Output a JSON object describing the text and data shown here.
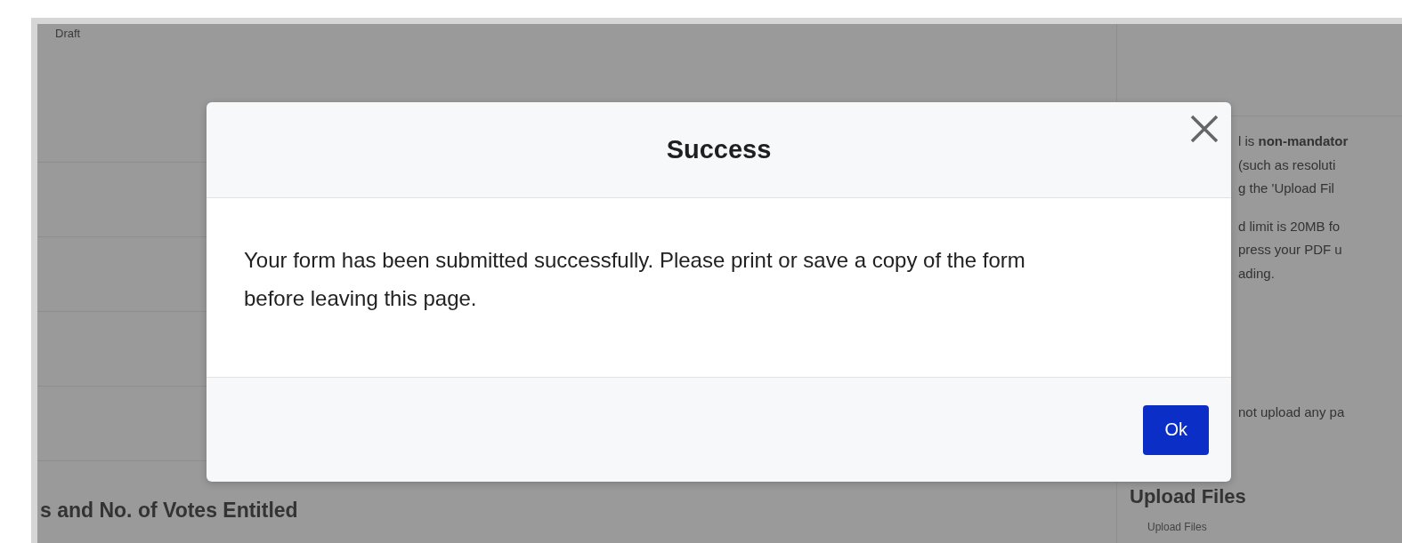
{
  "background_page": {
    "status": "Draft",
    "section_heading": "s and No. of Votes Entitled",
    "notes": [
      "l is **non-mandator**",
      "(such as resoluti",
      "g the 'Upload Fil",
      "d limit is 20MB fo",
      "press your PDF u",
      "ading.",
      "not upload any pa"
    ],
    "upload_heading": "Upload Files",
    "upload_label": "Upload Files"
  },
  "dialog": {
    "title": "Success",
    "message": "Your form has been submitted successfully. Please print or save a copy of the form before leaving this page.",
    "buttons": [
      {
        "label": "Ok",
        "kind": "primary"
      }
    ]
  }
}
